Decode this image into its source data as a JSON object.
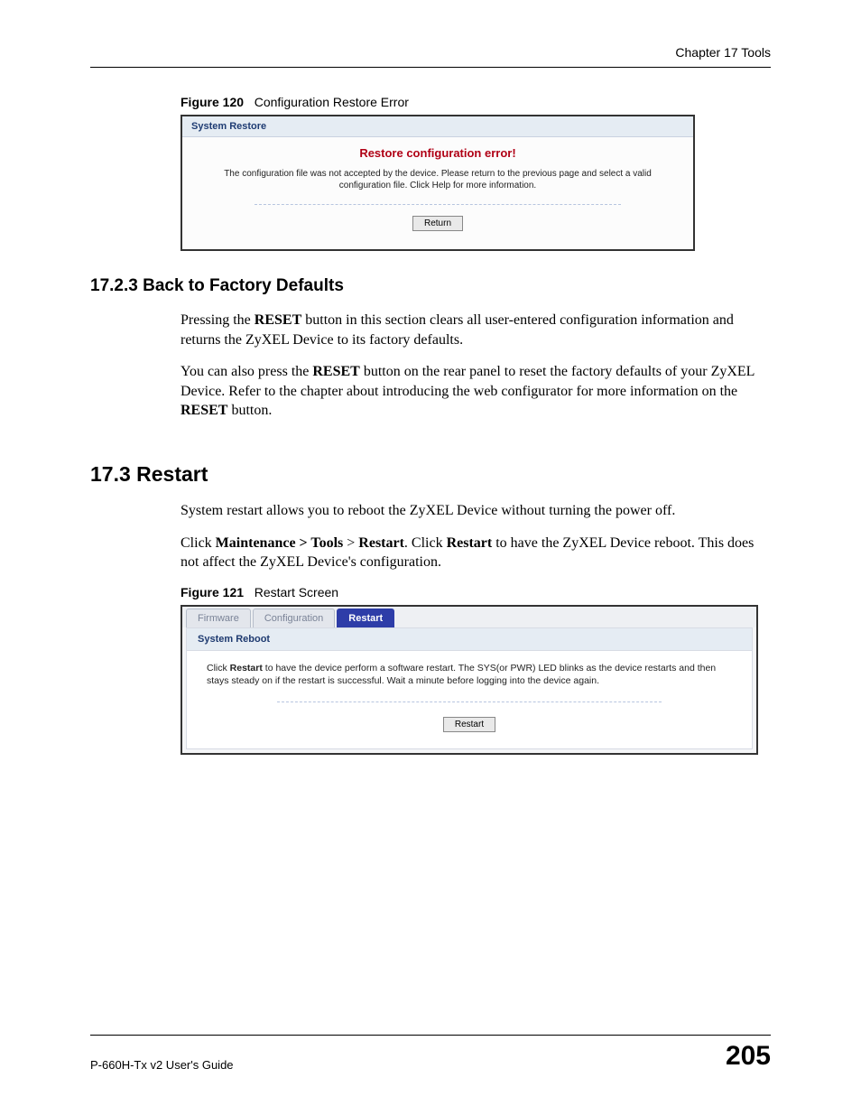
{
  "header": {
    "chapter": "Chapter 17 Tools"
  },
  "figure120": {
    "label": "Figure 120",
    "title": "Configuration Restore Error",
    "panel_title": "System Restore",
    "error_msg": "Restore configuration error!",
    "sub_msg": "The configuration file was not accepted by the device. Please return to the previous page and select a valid configuration file. Click Help for more information.",
    "return_btn": "Return"
  },
  "section_1723": {
    "heading": "17.2.3  Back to Factory Defaults",
    "p1_a": "Pressing the ",
    "p1_b": "RESET",
    "p1_c": " button in this section clears all user-entered configuration information and returns the ZyXEL Device to its factory defaults.",
    "p2_a": "You can also press the ",
    "p2_b": "RESET",
    "p2_c": " button on the rear panel to reset the factory defaults of your ZyXEL Device. Refer to the chapter about introducing the web configurator for more information on the ",
    "p2_d": "RESET",
    "p2_e": " button."
  },
  "section_173": {
    "heading": "17.3  Restart",
    "p1": "System restart allows you to reboot the ZyXEL Device without turning the power off.",
    "p2_a": "Click ",
    "p2_b": "Maintenance > Tools",
    "p2_c": " > ",
    "p2_d": "Restart",
    "p2_e": ". Click ",
    "p2_f": "Restart",
    "p2_g": " to have the ZyXEL Device reboot. This does not affect the ZyXEL Device's configuration."
  },
  "figure121": {
    "label": "Figure 121",
    "title": "Restart Screen",
    "tabs": {
      "firmware": "Firmware",
      "configuration": "Configuration",
      "restart": "Restart"
    },
    "panel_title": "System Reboot",
    "desc_a": "Click ",
    "desc_b": "Restart",
    "desc_c": " to have the device perform a software restart. The SYS(or PWR) LED blinks as the device restarts and then stays steady on if the restart is successful. Wait a minute before logging into the device again.",
    "restart_btn": "Restart"
  },
  "footer": {
    "guide": "P-660H-Tx v2 User's Guide",
    "page": "205"
  }
}
